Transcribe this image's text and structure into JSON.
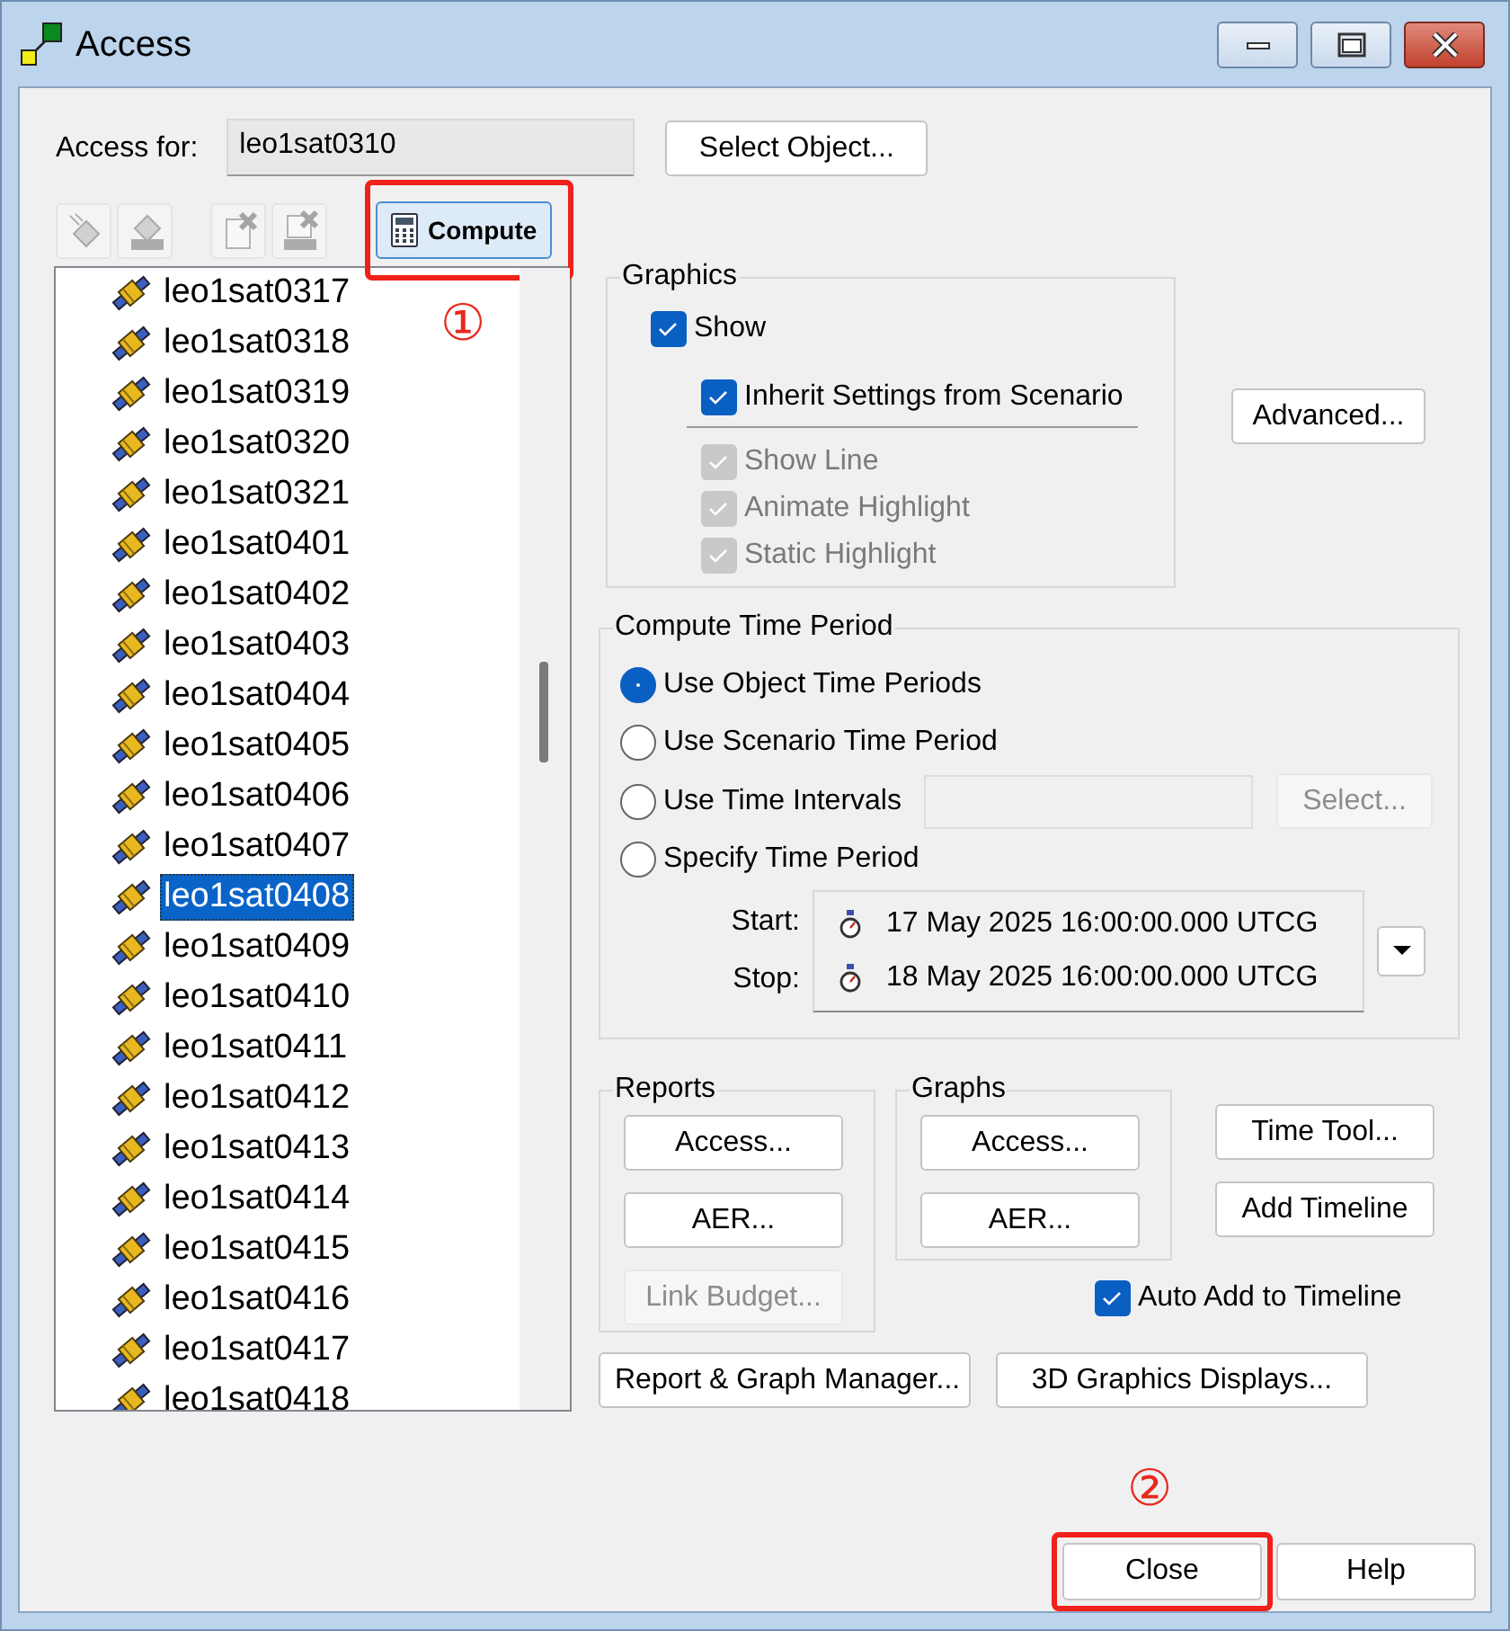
{
  "window": {
    "title": "Access"
  },
  "access_for": {
    "label": "Access for:",
    "value": "leo1sat0310",
    "button": "Select Object..."
  },
  "toolbar": [
    {
      "kind": "remove",
      "disabled": true
    },
    {
      "kind": "remove-all",
      "disabled": true
    },
    {
      "kind": "delete",
      "disabled": true
    },
    {
      "kind": "delete-all",
      "disabled": true
    },
    {
      "kind": "compute",
      "label": "Compute",
      "highlighted": true,
      "callout": "①"
    }
  ],
  "objects": [
    {
      "label": "leo1sat0317",
      "selected": false
    },
    {
      "label": "leo1sat0318",
      "selected": false
    },
    {
      "label": "leo1sat0319",
      "selected": false
    },
    {
      "label": "leo1sat0320",
      "selected": false
    },
    {
      "label": "leo1sat0321",
      "selected": false
    },
    {
      "label": "leo1sat0401",
      "selected": false
    },
    {
      "label": "leo1sat0402",
      "selected": false
    },
    {
      "label": "leo1sat0403",
      "selected": false
    },
    {
      "label": "leo1sat0404",
      "selected": false
    },
    {
      "label": "leo1sat0405",
      "selected": false
    },
    {
      "label": "leo1sat0406",
      "selected": false
    },
    {
      "label": "leo1sat0407",
      "selected": false
    },
    {
      "label": "leo1sat0408",
      "selected": true
    },
    {
      "label": "leo1sat0409",
      "selected": false
    },
    {
      "label": "leo1sat0410",
      "selected": false
    },
    {
      "label": "leo1sat0411",
      "selected": false
    },
    {
      "label": "leo1sat0412",
      "selected": false
    },
    {
      "label": "leo1sat0413",
      "selected": false
    },
    {
      "label": "leo1sat0414",
      "selected": false
    },
    {
      "label": "leo1sat0415",
      "selected": false
    },
    {
      "label": "leo1sat0416",
      "selected": false
    },
    {
      "label": "leo1sat0417",
      "selected": false
    },
    {
      "label": "leo1sat0418",
      "selected": false
    }
  ],
  "graphics": {
    "title": "Graphics",
    "options": [
      {
        "kind": "main",
        "label": "Show",
        "checked": true,
        "disabled": false
      },
      {
        "kind": "inherit",
        "label": "Inherit Settings from Scenario",
        "checked": true,
        "disabled": false
      },
      {
        "kind": "sub",
        "label": "Show Line",
        "checked": true,
        "disabled": true
      },
      {
        "kind": "sub",
        "label": "Animate Highlight",
        "checked": true,
        "disabled": true
      },
      {
        "kind": "sub",
        "label": "Static Highlight",
        "checked": true,
        "disabled": true
      }
    ],
    "advanced_button": "Advanced..."
  },
  "time_period": {
    "title": "Compute Time Period",
    "options": [
      {
        "label": "Use Object Time Periods",
        "selected": true
      },
      {
        "label": "Use Scenario Time Period",
        "selected": false
      },
      {
        "label": "Use Time Intervals",
        "selected": false
      },
      {
        "label": "Specify Time Period",
        "selected": false
      }
    ],
    "intervals_button": {
      "label": "Select...",
      "disabled": true
    },
    "start": {
      "label": "Start:",
      "value": "17 May 2025 16:00:00.000 UTCG"
    },
    "stop": {
      "label": "Stop:",
      "value": "18 May 2025 16:00:00.000 UTCG"
    }
  },
  "reports": {
    "title": "Reports",
    "buttons": [
      {
        "label": "Access...",
        "disabled": false
      },
      {
        "label": "AER...",
        "disabled": false
      },
      {
        "label": "Link Budget...",
        "disabled": true
      }
    ]
  },
  "graphs": {
    "title": "Graphs",
    "buttons": [
      {
        "label": "Access...",
        "disabled": false
      },
      {
        "label": "AER...",
        "disabled": false
      }
    ]
  },
  "side_buttons": [
    "Time Tool...",
    "Add Timeline"
  ],
  "auto_add": {
    "label": "Auto Add to Timeline",
    "checked": true
  },
  "bottom_buttons": [
    "Report & Graph Manager...",
    "3D Graphics Displays..."
  ],
  "footer_buttons": [
    {
      "label": "Close",
      "highlighted": true,
      "callout": "②"
    },
    {
      "label": "Help"
    }
  ]
}
